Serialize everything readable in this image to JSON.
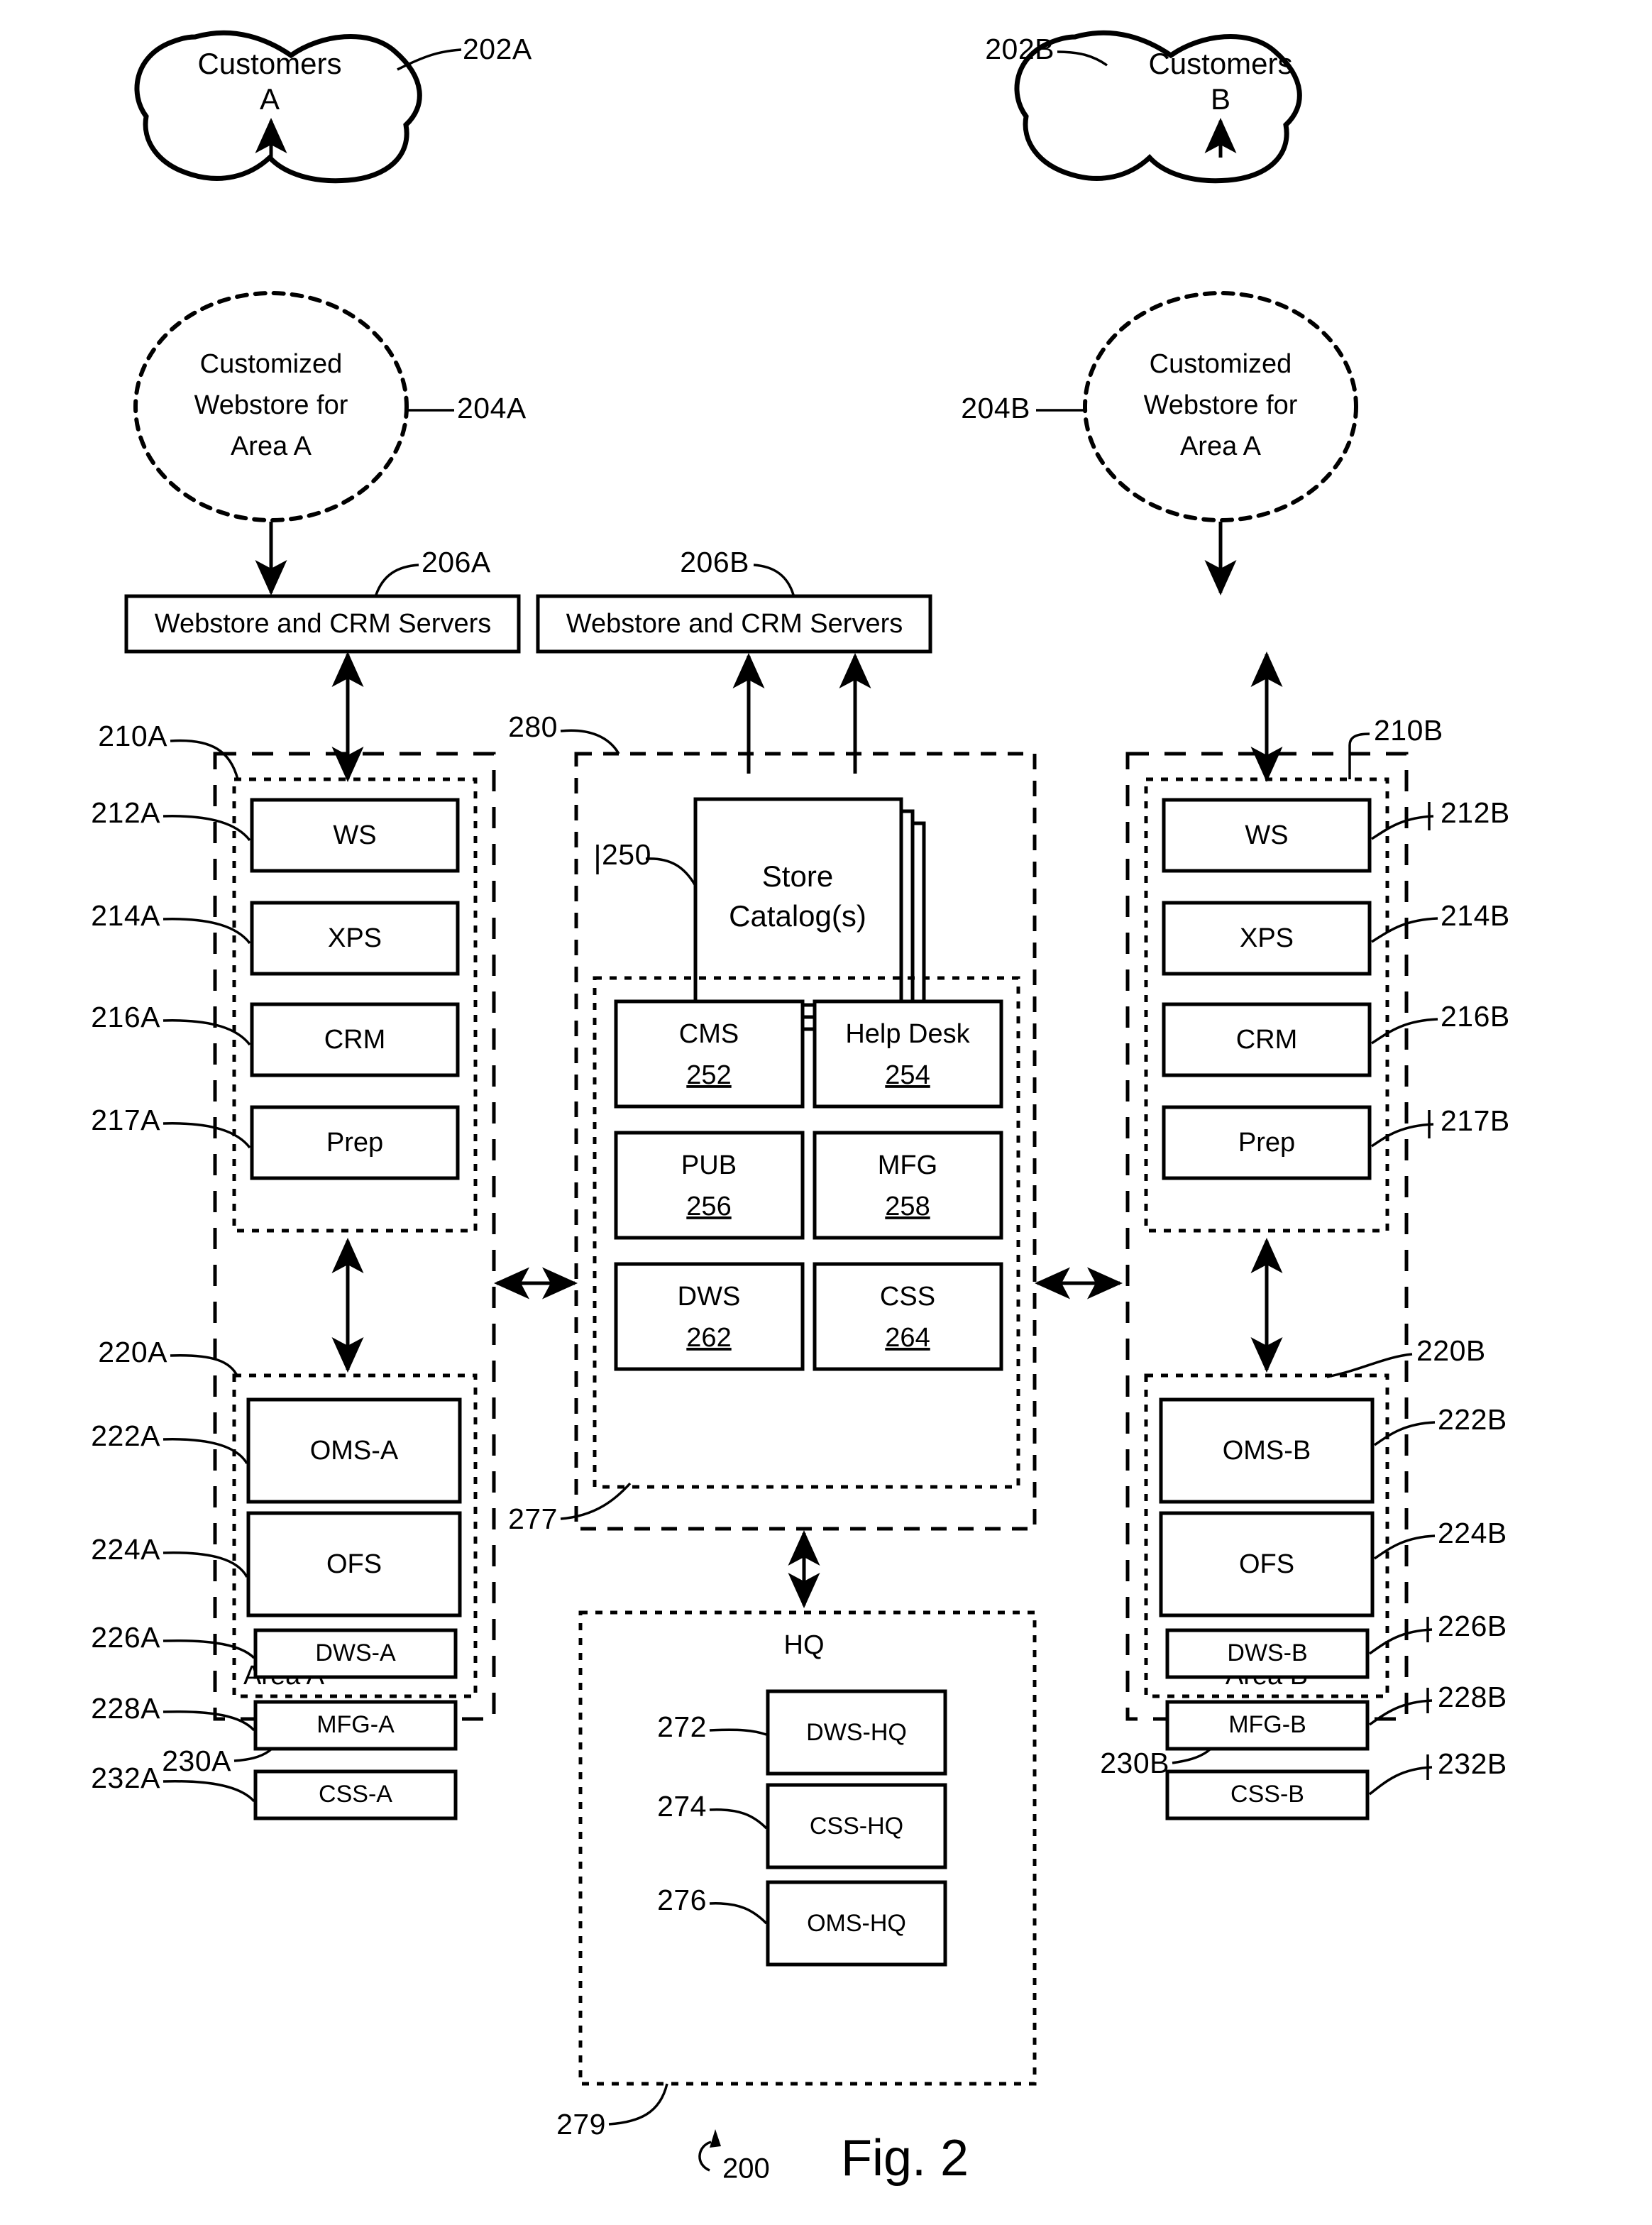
{
  "figure": {
    "caption": "Fig. 2",
    "system_number": "200"
  },
  "top": {
    "customers_a": {
      "line1": "Customers",
      "line2": "A",
      "ref": "202A"
    },
    "customers_b": {
      "line1": "Customers",
      "line2": "B",
      "ref": "202B"
    },
    "webstore_a": {
      "line1": "Customized",
      "line2": "Webstore for",
      "line3": "Area A",
      "ref": "204A"
    },
    "webstore_b": {
      "line1": "Customized",
      "line2": "Webstore for",
      "line3": "Area A",
      "ref": "204B"
    },
    "servers_a": {
      "label": "Webstore and CRM Servers",
      "ref": "206A"
    },
    "servers_b": {
      "label": "Webstore and CRM Servers",
      "ref": "206B"
    }
  },
  "area_a": {
    "area_label": "Area A",
    "area_ref": "230A",
    "front_group_ref": "210A",
    "back_group_ref": "220A",
    "front_items": [
      {
        "label": "WS",
        "ref": "212A"
      },
      {
        "label": "XPS",
        "ref": "214A"
      },
      {
        "label": "CRM",
        "ref": "216A"
      },
      {
        "label": "Prep",
        "ref": "217A"
      }
    ],
    "back_items": [
      {
        "label": "OMS-A",
        "ref": "222A"
      },
      {
        "label": "OFS",
        "ref": "224A"
      },
      {
        "label": "DWS-A",
        "ref": "226A"
      },
      {
        "label": "MFG-A",
        "ref": "228A"
      },
      {
        "label": "CSS-A",
        "ref": "232A"
      }
    ]
  },
  "area_b": {
    "area_label": "Area B",
    "area_ref": "230B",
    "front_group_ref": "210B",
    "back_group_ref": "220B",
    "front_items": [
      {
        "label": "WS",
        "ref": "212B"
      },
      {
        "label": "XPS",
        "ref": "214B"
      },
      {
        "label": "CRM",
        "ref": "216B"
      },
      {
        "label": "Prep",
        "ref": "217B"
      }
    ],
    "back_items": [
      {
        "label": "OMS-B",
        "ref": "222B"
      },
      {
        "label": "OFS",
        "ref": "224B"
      },
      {
        "label": "DWS-B",
        "ref": "226B"
      },
      {
        "label": "MFG-B",
        "ref": "228B"
      },
      {
        "label": "CSS-B",
        "ref": "232B"
      }
    ]
  },
  "center": {
    "outer_ref": "280",
    "inner_ref": "277",
    "catalog": {
      "line1": "Store",
      "line2": "Catalog(s)",
      "ref": "250"
    },
    "services": [
      {
        "label": "CMS",
        "ref": "252"
      },
      {
        "label": "Help Desk",
        "ref": "254"
      },
      {
        "label": "PUB",
        "ref": "256"
      },
      {
        "label": "MFG",
        "ref": "258"
      },
      {
        "label": "DWS",
        "ref": "262"
      },
      {
        "label": "CSS",
        "ref": "264"
      }
    ]
  },
  "hq": {
    "title": "HQ",
    "ref": "279",
    "items": [
      {
        "label": "DWS-HQ",
        "ref": "272"
      },
      {
        "label": "CSS-HQ",
        "ref": "274"
      },
      {
        "label": "OMS-HQ",
        "ref": "276"
      }
    ]
  }
}
